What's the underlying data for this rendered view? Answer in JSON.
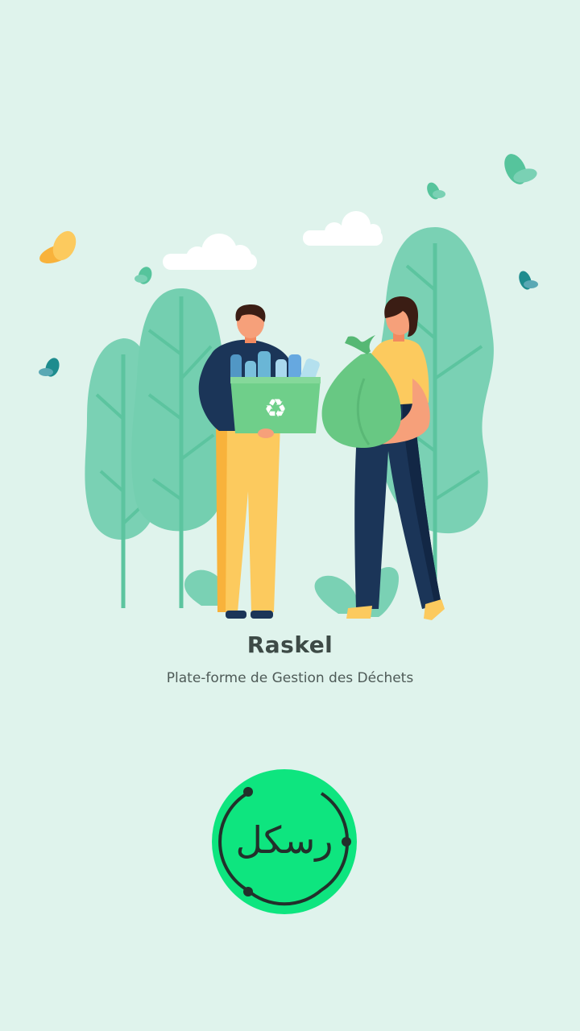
{
  "app": {
    "title": "Raskel",
    "subtitle": "Plate-forme de Gestion des Déchets"
  },
  "logo": {
    "text": "رسكل",
    "background_color": "#0ee57f",
    "stroke_color": "#22302b"
  },
  "illustration": {
    "icons": [
      "tree-icon",
      "cloud-icon",
      "butterfly-icon",
      "recycling-bin-icon",
      "garbage-bag-icon",
      "person-icon"
    ],
    "colors": {
      "background": "#dff3ec",
      "tree": "#7ad1b4",
      "tree_branch": "#5cc49f",
      "cloud": "#ffffff",
      "butterfly_orange": "#f8b23b",
      "butterfly_teal": "#1e8c8e",
      "butterfly_green": "#56c49c",
      "navy": "#1b3558",
      "yellow": "#fcca5e",
      "bin_green": "#6fcf8a",
      "bag_green": "#68c883"
    }
  }
}
